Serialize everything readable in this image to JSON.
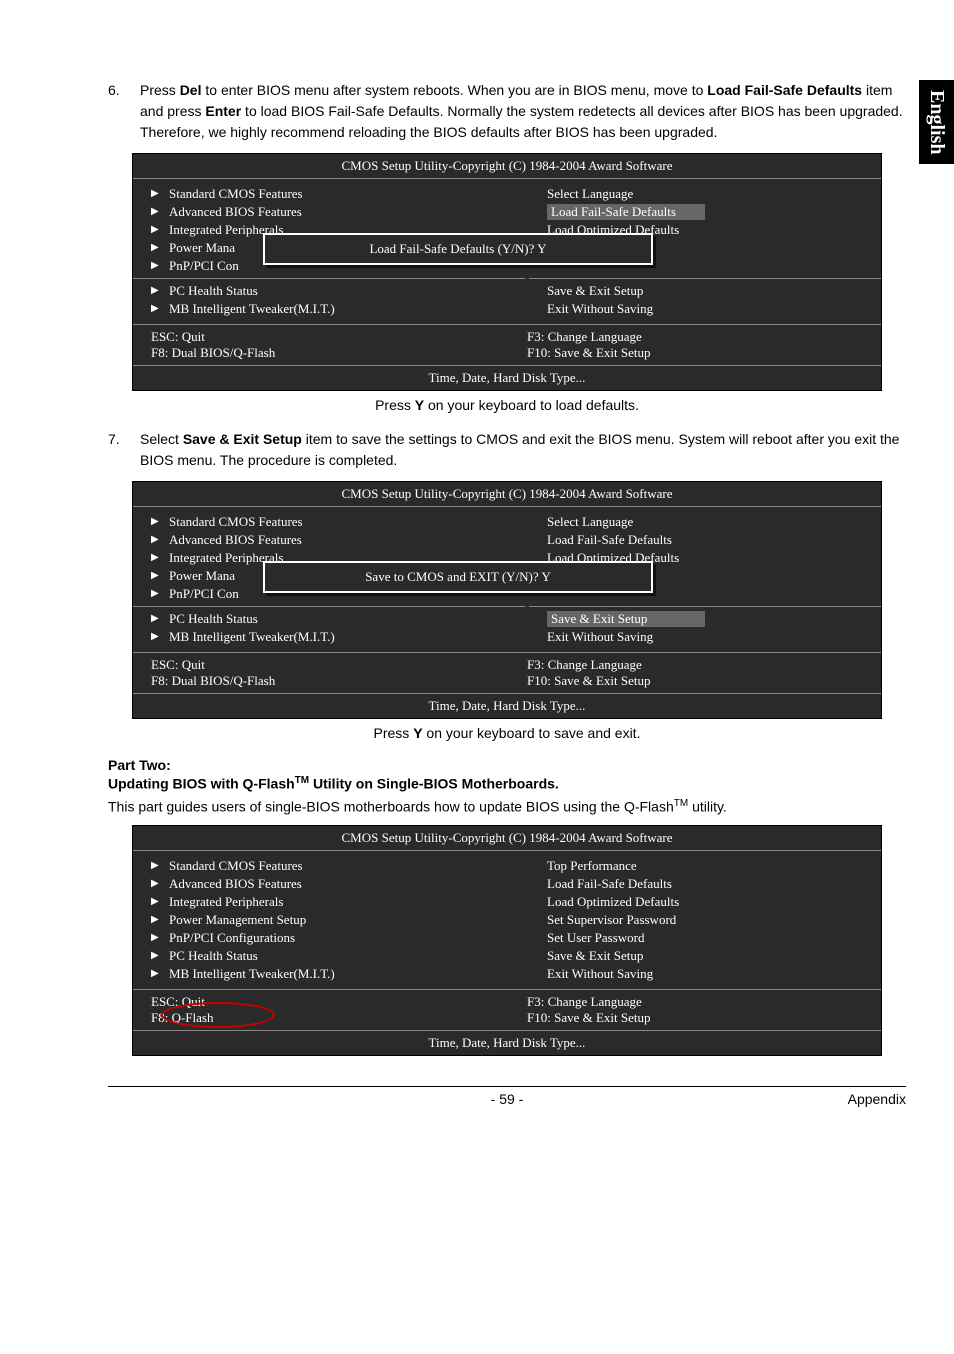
{
  "sideTab": "English",
  "step6": {
    "num": "6.",
    "line1a": "Press ",
    "del": "Del",
    "line1b": " to enter BIOS menu after system reboots. When you are in BIOS menu, move to ",
    "lfs": "Load Fail-Safe Defaults",
    "line2a": " item and press ",
    "enter": "Enter",
    "line2b": " to load BIOS Fail-Safe Defaults. Normally the system redetects all devices after BIOS has been upgraded. Therefore, we highly recommend reloading the BIOS defaults after BIOS has been upgraded."
  },
  "bios1": {
    "title": "CMOS Setup Utility-Copyright (C) 1984-2004 Award Software",
    "left": [
      "Standard CMOS Features",
      "Advanced BIOS Features",
      "Integrated Peripherals",
      "Power Mana",
      "PnP/PCI Con",
      "PC Health Status",
      "MB Intelligent Tweaker(M.I.T.)"
    ],
    "right": [
      {
        "label": "Select Language",
        "hl": false
      },
      {
        "label": "Load Fail-Safe Defaults",
        "hl": true
      },
      {
        "label": "Load Optimized Defaults",
        "hl": false
      },
      {
        "label": "",
        "hl": false
      },
      {
        "label": "",
        "hl": false
      },
      {
        "label": "Save & Exit Setup",
        "hl": false
      },
      {
        "label": "Exit Without Saving",
        "hl": false
      }
    ],
    "dialog": "Load Fail-Safe Defaults (Y/N)? Y",
    "footerL1": "ESC: Quit",
    "footerL2": "F8: Dual BIOS/Q-Flash",
    "footerR1": "F3: Change Language",
    "footerR2": "F10: Save & Exit Setup",
    "help": "Time, Date, Hard Disk Type..."
  },
  "caption1a": "Press ",
  "caption1Y": "Y",
  "caption1b": " on your keyboard to load defaults.",
  "step7": {
    "num": "7.",
    "line1a": "Select ",
    "ses": "Save & Exit Setup",
    "line1b": " item to save the settings to CMOS and exit the BIOS menu. System will reboot after you exit the BIOS menu. The procedure is completed."
  },
  "bios2": {
    "title": "CMOS Setup Utility-Copyright (C) 1984-2004 Award Software",
    "left": [
      "Standard CMOS Features",
      "Advanced BIOS Features",
      "Integrated Peripherals",
      "Power Mana",
      "PnP/PCI Con",
      "PC Health Status",
      "MB Intelligent Tweaker(M.I.T.)"
    ],
    "right": [
      {
        "label": "Select Language",
        "hl": false
      },
      {
        "label": "Load Fail-Safe Defaults",
        "hl": false
      },
      {
        "label": "Load Optimized Defaults",
        "hl": false
      },
      {
        "label": "",
        "hl": false
      },
      {
        "label": "",
        "hl": false
      },
      {
        "label": "Save & Exit Setup",
        "hl": true
      },
      {
        "label": "Exit Without Saving",
        "hl": false
      }
    ],
    "dialog": "Save to CMOS and EXIT (Y/N)? Y",
    "footerL1": "ESC: Quit",
    "footerL2": "F8: Dual BIOS/Q-Flash",
    "footerR1": "F3: Change Language",
    "footerR2": "F10: Save & Exit Setup",
    "help": "Time, Date, Hard Disk Type..."
  },
  "caption2a": "Press ",
  "caption2Y": "Y",
  "caption2b": " on your keyboard to save and exit.",
  "partTwo": {
    "head": "Part Two:",
    "sub1": "Updating BIOS with Q-Flash",
    "tm": "TM",
    "sub2": " Utility on Single-BIOS Motherboards.",
    "para1": "This part guides users of single-BIOS motherboards how to update BIOS using the Q-Flash",
    "para2": " utility."
  },
  "bios3": {
    "title": "CMOS Setup Utility-Copyright (C) 1984-2004 Award Software",
    "left": [
      "Standard CMOS Features",
      "Advanced BIOS Features",
      "Integrated Peripherals",
      "Power Management Setup",
      "PnP/PCI Configurations",
      "PC Health Status",
      "MB Intelligent Tweaker(M.I.T.)"
    ],
    "right": [
      "Top Performance",
      "Load Fail-Safe Defaults",
      "Load Optimized Defaults",
      "Set Supervisor Password",
      "Set User Password",
      "Save & Exit Setup",
      "Exit Without Saving"
    ],
    "footerL1": "ESC: Quit",
    "footerL2": "F8: Q-Flash",
    "footerR1": "F3: Change Language",
    "footerR2": "F10: Save & Exit Setup",
    "help": "Time, Date, Hard Disk Type..."
  },
  "footer": {
    "pageNum": "- 59 -",
    "right": "Appendix"
  }
}
